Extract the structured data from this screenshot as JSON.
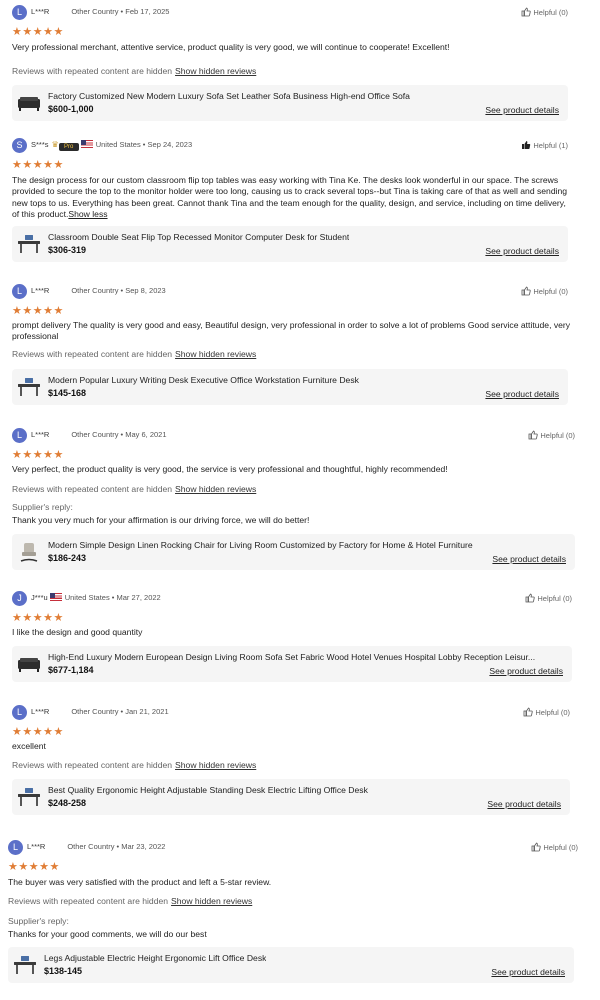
{
  "reviews": [
    {
      "avatar_letter": "L",
      "reviewer": "L***R",
      "flag": false,
      "badge": false,
      "country": "Other Country",
      "date": "Feb 17, 2025",
      "helpful": "Helpful (0)",
      "helpful_filled": false,
      "stars": "★★★★★",
      "text": "Very professional merchant, attentive service, product quality is very good, we will continue to cooperate! Excellent!",
      "show_less": "",
      "hidden_note": "Reviews with repeated content are hidden",
      "hidden_link": "Show hidden reviews",
      "reply_label": "",
      "reply_text": "",
      "product": {
        "thumb_icon": "sofa-thumbnail",
        "name": "Factory Customized New Modern Luxury Sofa Set Leather Sofa Business High-end Office Sofa",
        "price": "$600-1,000",
        "link": "See product details"
      }
    },
    {
      "avatar_letter": "S",
      "reviewer": "S***s",
      "flag": true,
      "badge": true,
      "badge_text": "Pro",
      "country": "United States",
      "date": "Sep 24, 2023",
      "helpful": "Helpful (1)",
      "helpful_filled": true,
      "stars": "★★★★★",
      "text": "The design process for our custom classroom flip top tables was easy working with Tina Ke. The desks look wonderful in our space. The screws provided to secure the top to the monitor holder were too long, causing us to crack several tops--but Tina is taking care of that as well and sending new tops to us. Everything has been great. Cannot thank Tina and the team enough for the quality, design, and service, including on time delivery, of this product.",
      "show_less": "Show less",
      "hidden_note": "",
      "hidden_link": "",
      "reply_label": "",
      "reply_text": "",
      "product": {
        "thumb_icon": "desk-thumbnail",
        "name": "Classroom Double Seat Flip Top Recessed Monitor Computer Desk for Student",
        "price": "$306-319",
        "link": "See product details"
      }
    },
    {
      "avatar_letter": "L",
      "reviewer": "L***R",
      "flag": false,
      "badge": false,
      "country": "Other Country",
      "date": "Sep 8, 2023",
      "helpful": "Helpful (0)",
      "helpful_filled": false,
      "stars": "★★★★★",
      "text": "prompt delivery The quality is very good and easy, Beautiful design, very professional in order to solve a lot of problems Good service attitude, very professional",
      "show_less": "",
      "hidden_note": "Reviews with repeated content are hidden",
      "hidden_link": "Show hidden reviews",
      "reply_label": "",
      "reply_text": "",
      "product": {
        "thumb_icon": "desk-thumbnail",
        "name": "Modern Popular Luxury Writing Desk Executive Office Workstation Furniture Desk",
        "price": "$145-168",
        "link": "See product details"
      }
    },
    {
      "avatar_letter": "L",
      "reviewer": "L***R",
      "flag": false,
      "badge": false,
      "country": "Other Country",
      "date": "May 6, 2021",
      "helpful": "Helpful (0)",
      "helpful_filled": false,
      "stars": "★★★★★",
      "text": "Very perfect, the product quality is very good, the service is very professional and thoughtful, highly recommended!",
      "show_less": "",
      "hidden_note": "Reviews with repeated content are hidden",
      "hidden_link": "Show hidden reviews",
      "reply_label": "Supplier's reply:",
      "reply_text": "Thank you very much for your affirmation is our driving force, we will do better!",
      "product": {
        "thumb_icon": "chair-thumbnail",
        "name": "Modern Simple Design Linen Rocking Chair for Living Room Customized by Factory for Home & Hotel Furniture",
        "price": "$186-243",
        "link": "See product details"
      }
    },
    {
      "avatar_letter": "J",
      "reviewer": "J***u",
      "flag": true,
      "badge": false,
      "country": "United States",
      "date": "Mar 27, 2022",
      "helpful": "Helpful (0)",
      "helpful_filled": false,
      "stars": "★★★★★",
      "text": "I like the design and good quantity",
      "show_less": "",
      "hidden_note": "",
      "hidden_link": "",
      "reply_label": "",
      "reply_text": "",
      "product": {
        "thumb_icon": "sofa-thumbnail",
        "name": "High-End Luxury Modern European Design Living Room Sofa Set Fabric Wood Hotel Venues Hospital Lobby Reception Leisur...",
        "price": "$677-1,184",
        "link": "See product details"
      }
    },
    {
      "avatar_letter": "L",
      "reviewer": "L***R",
      "flag": false,
      "badge": false,
      "country": "Other Country",
      "date": "Jan 21, 2021",
      "helpful": "Helpful (0)",
      "helpful_filled": false,
      "stars": "★★★★★",
      "text": "excellent",
      "show_less": "",
      "hidden_note": "Reviews with repeated content are hidden",
      "hidden_link": "Show hidden reviews",
      "reply_label": "",
      "reply_text": "",
      "product": {
        "thumb_icon": "desk-thumbnail",
        "name": "Best Quality Ergonomic Height Adjustable Standing Desk Electric Lifting Office Desk",
        "price": "$248-258",
        "link": "See product details"
      }
    },
    {
      "avatar_letter": "L",
      "reviewer": "L***R",
      "flag": false,
      "badge": false,
      "country": "Other Country",
      "date": "Mar 23, 2022",
      "helpful": "Helpful (0)",
      "helpful_filled": false,
      "stars": "★★★★★",
      "text": "The buyer was very satisfied with the product and left a 5-star review.",
      "show_less": "",
      "hidden_note": "Reviews with repeated content are hidden",
      "hidden_link": "Show hidden reviews",
      "reply_label": "Supplier's reply:",
      "reply_text": "Thanks for your good comments, we will do our best",
      "product": {
        "thumb_icon": "desk-thumbnail",
        "name": "Legs Adjustable Electric Height Ergonomic Lift Office Desk",
        "price": "$138-145",
        "link": "See product details"
      }
    }
  ],
  "colors": {
    "star": "#e07d35",
    "avatar": "#5b6fc8",
    "product_bg": "#f5f5f5"
  }
}
